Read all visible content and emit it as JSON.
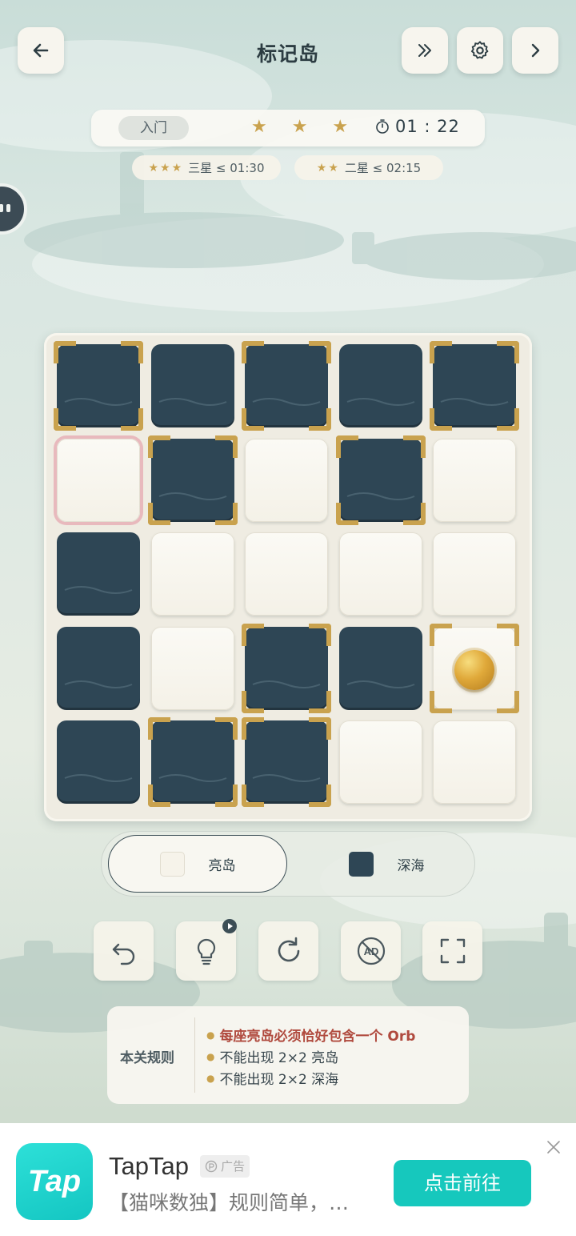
{
  "header": {
    "title": "标记岛",
    "back_icon": "arrow-left-icon",
    "skip_icon": "double-chevron-right-icon",
    "settings_icon": "gear-icon",
    "next_icon": "chevron-right-icon"
  },
  "status": {
    "difficulty": "入门",
    "stars": "★ ★ ★",
    "timer": "01 : 22"
  },
  "goals": [
    {
      "stars": "★★★",
      "label": "三星 ≤ 01:30"
    },
    {
      "stars": "★★",
      "label": "二星 ≤ 02:15"
    }
  ],
  "board": {
    "rows": 5,
    "cols": 5,
    "cells": [
      [
        "sea",
        "sea",
        "sea",
        "sea",
        "sea"
      ],
      [
        "land",
        "sea",
        "land",
        "sea",
        "land"
      ],
      [
        "sea",
        "land",
        "land",
        "land",
        "land"
      ],
      [
        "sea",
        "land",
        "sea",
        "sea",
        "land"
      ],
      [
        "sea",
        "sea",
        "sea",
        "land",
        "land"
      ]
    ],
    "marked": [
      [
        0,
        0
      ],
      [
        0,
        2
      ],
      [
        0,
        4
      ],
      [
        1,
        1
      ],
      [
        1,
        3
      ],
      [
        3,
        2
      ],
      [
        3,
        4
      ],
      [
        4,
        1
      ],
      [
        4,
        2
      ]
    ],
    "selected": [
      1,
      0
    ],
    "orb": [
      3,
      4
    ]
  },
  "modes": {
    "land_label": "亮岛",
    "sea_label": "深海",
    "active": "land",
    "colors": {
      "land": "#f6f3ea",
      "sea": "#2e4655",
      "gold": "#c9a24e"
    }
  },
  "tools": [
    {
      "name": "undo-button",
      "icon": "undo-icon"
    },
    {
      "name": "hint-button",
      "icon": "lightbulb-icon"
    },
    {
      "name": "restart-button",
      "icon": "refresh-icon"
    },
    {
      "name": "no-ads-button",
      "icon": "no-ads-icon",
      "text": "AD"
    },
    {
      "name": "fullscreen-button",
      "icon": "fullscreen-icon"
    }
  ],
  "rules": {
    "title": "本关规则",
    "items": [
      "每座亮岛必须恰好包含一个 Orb",
      "不能出现 2×2 亮岛",
      "不能出现 2×2 深海"
    ]
  },
  "ad": {
    "logo_text": "Tap",
    "name": "TapTap",
    "badge": "广告",
    "description": "【猫咪数独】规则简单，…",
    "cta": "点击前往"
  }
}
